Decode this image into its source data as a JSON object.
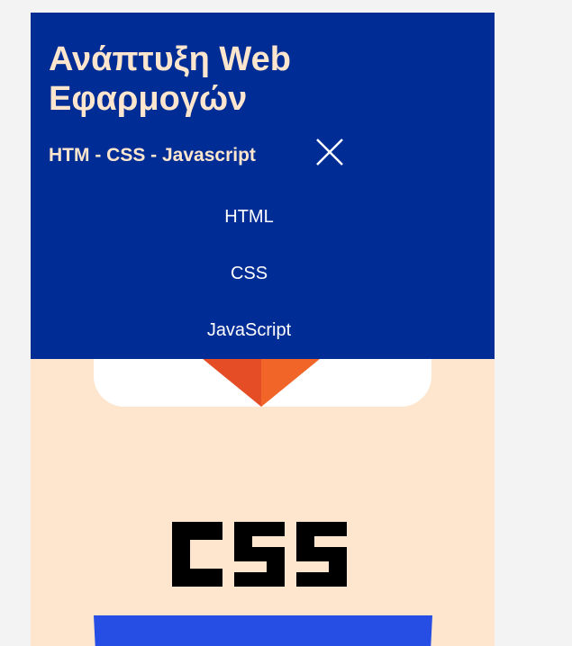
{
  "header": {
    "title": "Ανάπτυξη Web Εφαρμογών",
    "subtitle": "HTM - CSS - Javascript",
    "close_icon": "close-icon"
  },
  "nav": {
    "items": [
      {
        "label": "HTML"
      },
      {
        "label": "CSS"
      },
      {
        "label": "JavaScript"
      }
    ]
  },
  "content": {
    "logos": [
      "html5-logo",
      "css-logo"
    ]
  },
  "colors": {
    "header_bg": "#002d95",
    "title_color": "#fde6cd",
    "page_bg": "#fde6cd",
    "html_orange": "#e44d26",
    "html_orange_light": "#f16529",
    "css_blue": "#264de4"
  }
}
